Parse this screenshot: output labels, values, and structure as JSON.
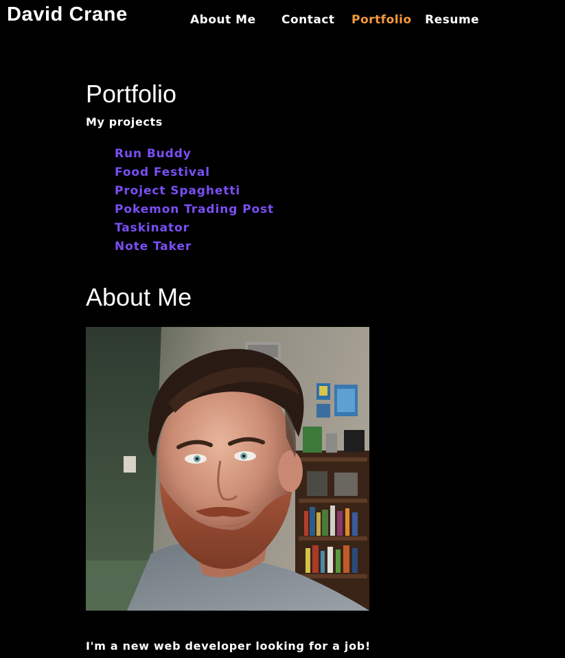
{
  "header": {
    "site_title": "David Crane",
    "nav": [
      {
        "label": "About Me",
        "active": false
      },
      {
        "label": "Contact",
        "active": false
      },
      {
        "label": "Portfolio",
        "active": true
      },
      {
        "label": "Resume",
        "active": false
      }
    ]
  },
  "portfolio": {
    "heading": "Portfolio",
    "subheading": "My projects",
    "projects": [
      {
        "label": "Run Buddy"
      },
      {
        "label": "Food Festival"
      },
      {
        "label": "Project Spaghetti"
      },
      {
        "label": "Pokemon Trading Post"
      },
      {
        "label": "Taskinator"
      },
      {
        "label": "Note Taker"
      }
    ]
  },
  "about": {
    "heading": "About Me",
    "bio": "I'm a new web developer looking for a job!"
  },
  "colors": {
    "background": "#000000",
    "text": "#ffffff",
    "nav_active": "#f59a3c",
    "project_link": "#7a4ff5"
  }
}
